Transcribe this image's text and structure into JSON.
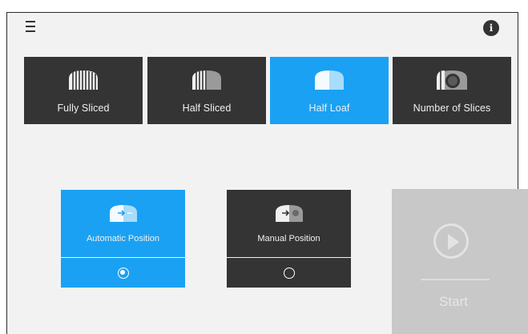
{
  "header": {
    "menu_icon": "hamburger-menu-icon",
    "info_icon": "info-icon",
    "info_glyph": "i"
  },
  "slice_modes": [
    {
      "label": "Fully Sliced",
      "icon": "fully-sliced-bread-icon",
      "active": false
    },
    {
      "label": "Half Sliced",
      "icon": "half-sliced-bread-icon",
      "active": false
    },
    {
      "label": "Half Loaf",
      "icon": "half-loaf-icon",
      "active": true
    },
    {
      "label": "Number of Slices",
      "icon": "number-of-slices-icon",
      "active": false
    }
  ],
  "positions": [
    {
      "label": "Automatic Position",
      "icon": "automatic-position-icon",
      "selected": true
    },
    {
      "label": "Manual Position",
      "icon": "manual-position-icon",
      "selected": false
    }
  ],
  "start": {
    "label": "Start",
    "icon": "play-icon"
  },
  "colors": {
    "accent": "#1aa1f4",
    "tile_dark": "#343434",
    "background": "#f2f2f2",
    "disabled": "#c8c8c8"
  }
}
